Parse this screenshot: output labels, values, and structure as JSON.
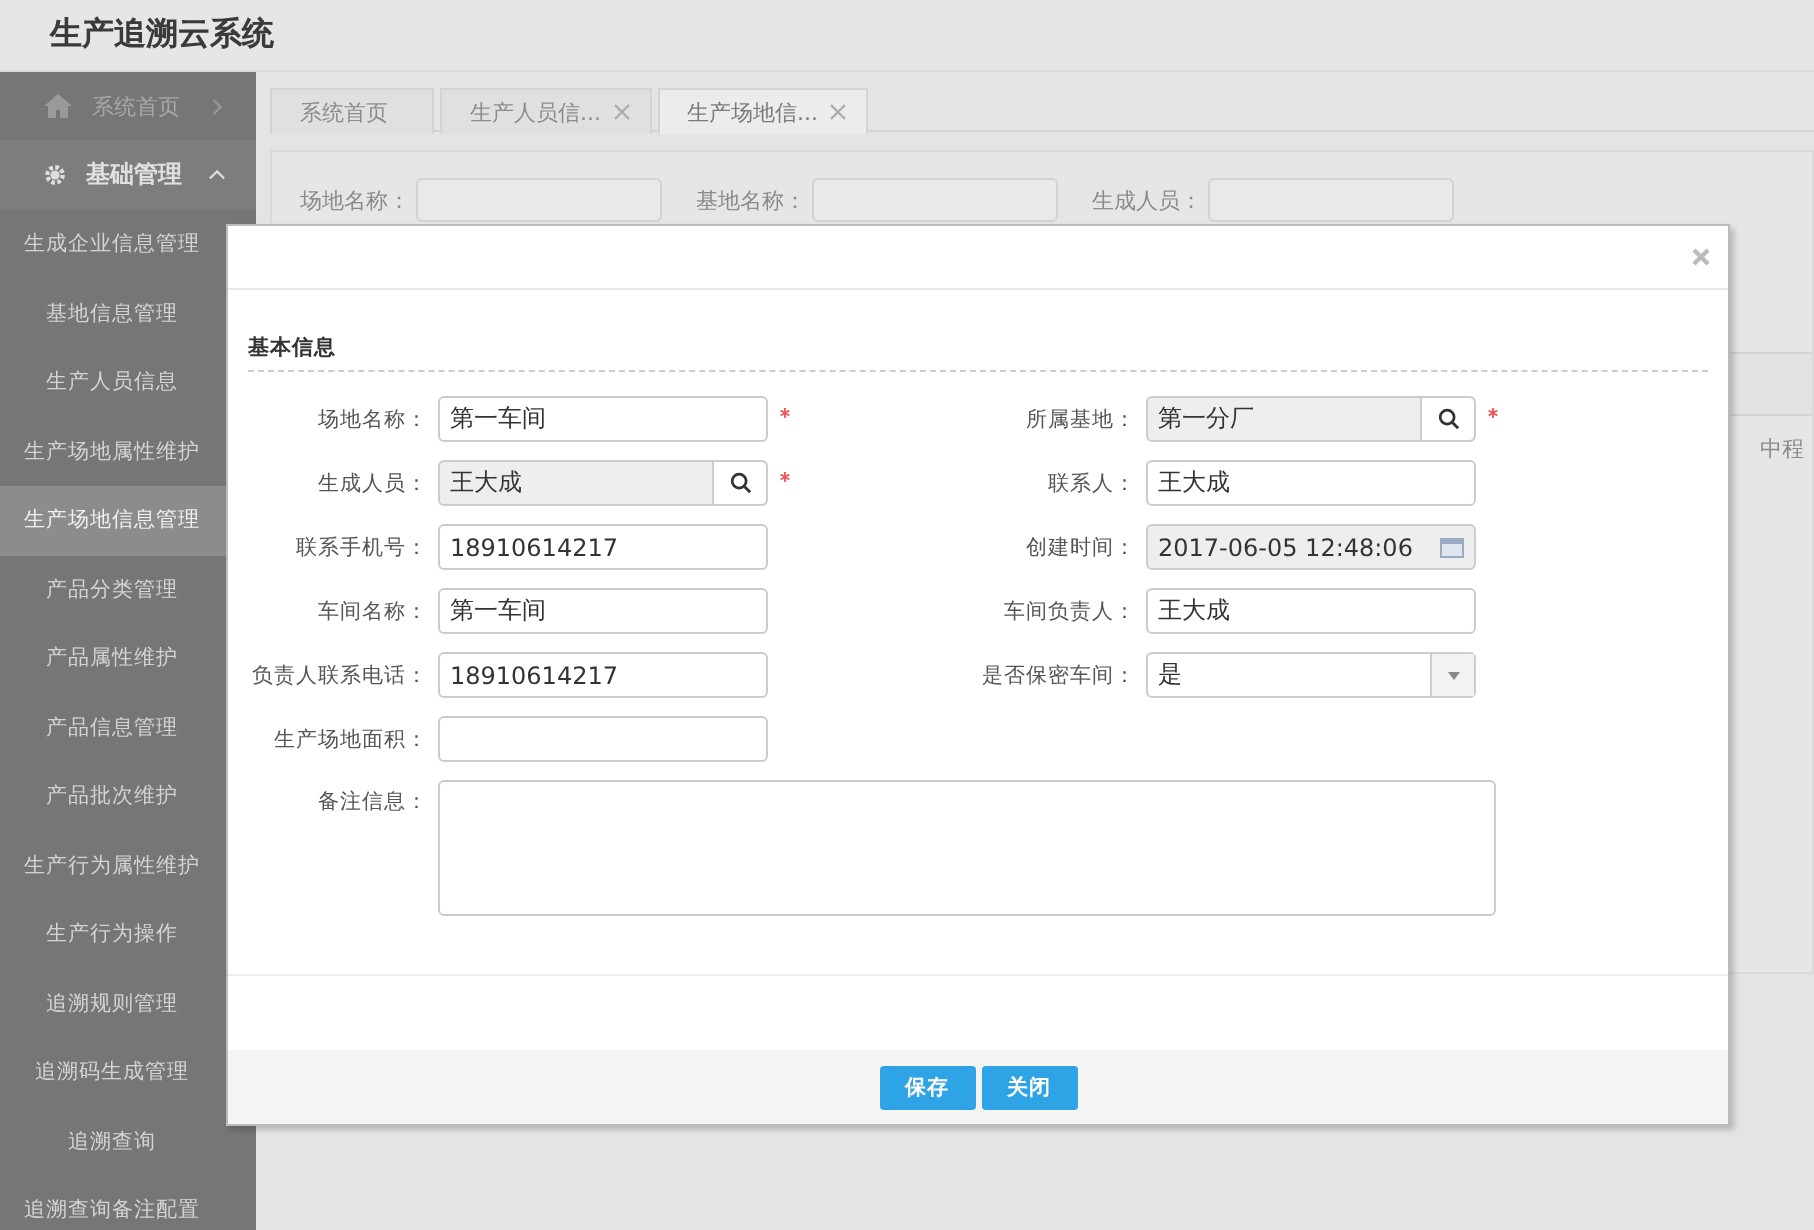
{
  "app_title": "生产追溯云系统",
  "sidebar": {
    "items": [
      {
        "label": "系统首页",
        "kind": "home",
        "expanded": false
      },
      {
        "label": "基础管理",
        "kind": "group",
        "expanded": true,
        "children": [
          {
            "label": "生成企业信息管理",
            "selected": false
          },
          {
            "label": "基地信息管理",
            "selected": false
          },
          {
            "label": "生产人员信息",
            "selected": false
          },
          {
            "label": "生产场地属性维护",
            "selected": false
          },
          {
            "label": "生产场地信息管理",
            "selected": true
          },
          {
            "label": "产品分类管理",
            "selected": false
          },
          {
            "label": "产品属性维护",
            "selected": false
          },
          {
            "label": "产品信息管理",
            "selected": false
          },
          {
            "label": "产品批次维护",
            "selected": false
          },
          {
            "label": "生产行为属性维护",
            "selected": false
          },
          {
            "label": "生产行为操作",
            "selected": false
          },
          {
            "label": "追溯规则管理",
            "selected": false
          },
          {
            "label": "追溯码生成管理",
            "selected": false
          },
          {
            "label": "追溯查询",
            "selected": false
          },
          {
            "label": "追溯查询备注配置",
            "selected": false
          }
        ]
      }
    ]
  },
  "tabs": [
    {
      "label": "系统首页",
      "closable": false,
      "selected": false
    },
    {
      "label": "生产人员信...",
      "closable": true,
      "selected": false
    },
    {
      "label": "生产场地信...",
      "closable": true,
      "selected": true
    }
  ],
  "search": [
    {
      "label": "场地名称："
    },
    {
      "label": "基地名称："
    },
    {
      "label": "生成人员："
    }
  ],
  "table": {
    "cell": "中程"
  },
  "dialog": {
    "section_title": "基本信息",
    "fields": [
      {
        "label": "场地名称：",
        "value": "第一车间",
        "kind": "text",
        "required": true
      },
      {
        "label": "所属基地：",
        "value": "第一分厂",
        "kind": "lookup",
        "required": true
      },
      {
        "label": "生成人员：",
        "value": "王大成",
        "kind": "lookup",
        "required": true
      },
      {
        "label": "联系人：",
        "value": "王大成",
        "kind": "text",
        "required": false
      },
      {
        "label": "联系手机号：",
        "value": "18910614217",
        "kind": "text",
        "required": false
      },
      {
        "label": "创建时间：",
        "value": "2017-06-05 12:48:06",
        "kind": "date",
        "required": false
      },
      {
        "label": "车间名称：",
        "value": "第一车间",
        "kind": "text",
        "required": false
      },
      {
        "label": "车间负责人：",
        "value": "王大成",
        "kind": "text",
        "required": false
      },
      {
        "label": "负责人联系电话：",
        "value": "18910614217",
        "kind": "text",
        "required": false
      },
      {
        "label": "是否保密车间：",
        "value": "是",
        "kind": "select",
        "required": false
      },
      {
        "label": "生产场地面积：",
        "kind": "text",
        "required": false
      },
      {
        "label": "备注信息：",
        "kind": "textarea",
        "required": false
      }
    ],
    "buttons": [
      "保存",
      "关闭"
    ]
  }
}
